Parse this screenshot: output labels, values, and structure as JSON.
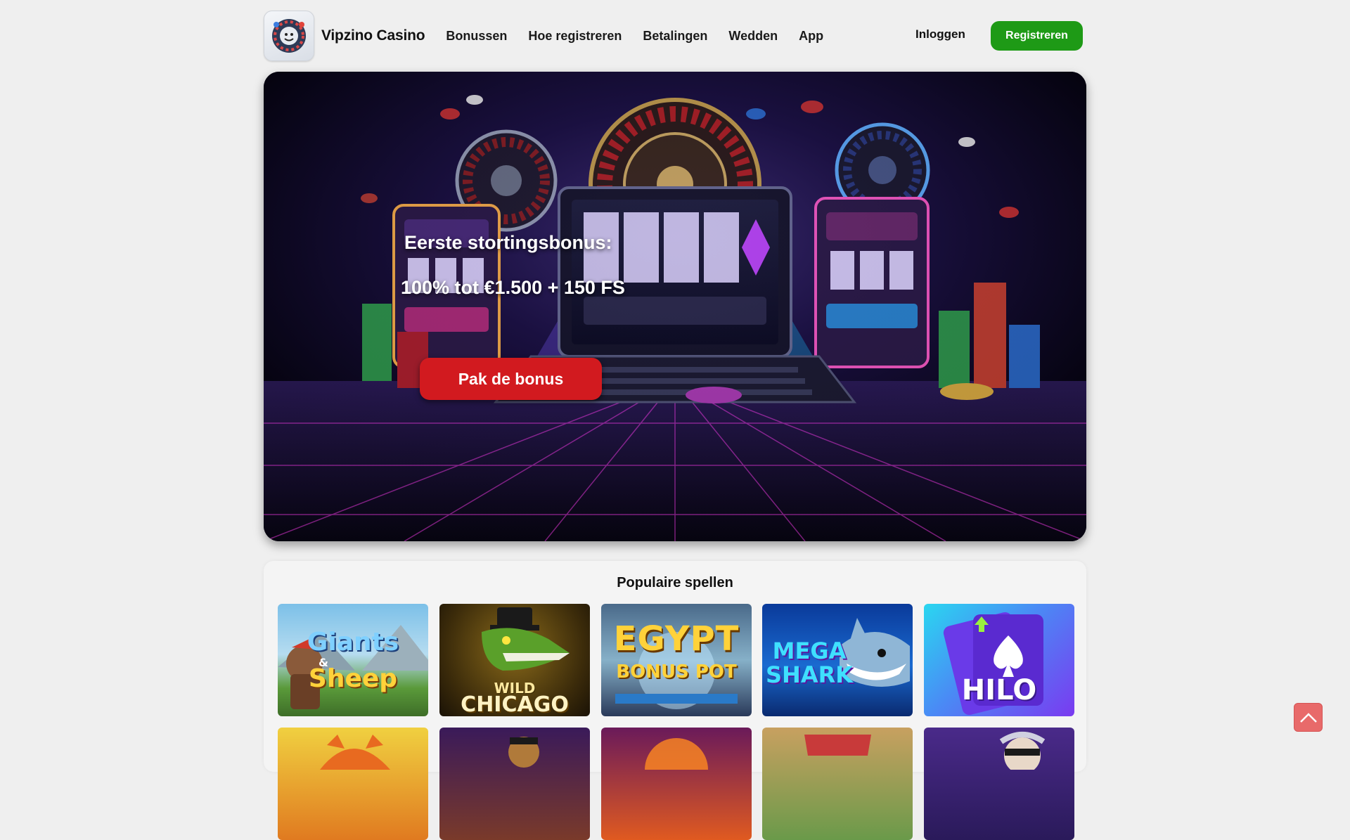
{
  "header": {
    "brand": "Vipzino Casino",
    "nav": [
      "Bonussen",
      "Hoe registreren",
      "Betalingen",
      "Wedden",
      "App"
    ],
    "login_label": "Inloggen",
    "register_label": "Registreren",
    "register_color": "#1e9a16"
  },
  "hero": {
    "line1": "Eerste stortingsbonus:",
    "line2": "100% tot €1.500 + 150 FS",
    "cta_label": "Pak de bonus",
    "cta_color": "#d21a1f"
  },
  "games": {
    "title": "Populaire spellen",
    "row1": [
      {
        "name": "Giants & Sheep",
        "logo_line1": "Giants",
        "logo_amp": "&",
        "logo_line2": "Sheep"
      },
      {
        "name": "Wild Chicago",
        "logo_line1": "WILD",
        "logo_line2": "CHICAGO"
      },
      {
        "name": "Egypt Bonus Pot",
        "logo_line1": "EGYPT",
        "logo_line2": "BONUS POT"
      },
      {
        "name": "Mega Shark",
        "logo_line1": "MEGA",
        "logo_line2": "SHARK"
      },
      {
        "name": "HiLo",
        "logo_line1": "HILO"
      }
    ]
  },
  "scroll_top_icon": "chevron-up-icon"
}
